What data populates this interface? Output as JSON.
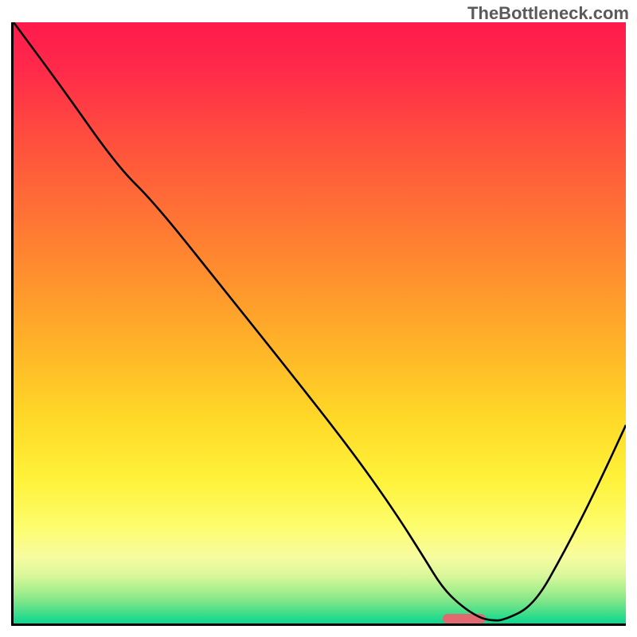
{
  "watermark": "TheBottleneck.com",
  "chart_data": {
    "type": "line",
    "title": "",
    "xlabel": "",
    "ylabel": "",
    "xlim": [
      0,
      100
    ],
    "ylim": [
      0,
      100
    ],
    "x": [
      0,
      8,
      17,
      23,
      34,
      45,
      55,
      62,
      67,
      70,
      73,
      76,
      78,
      80,
      85,
      90,
      95,
      100
    ],
    "values": [
      100,
      89,
      76,
      70,
      56,
      42,
      29,
      19,
      11,
      6,
      3,
      1,
      0.5,
      0.5,
      3,
      12,
      22,
      33
    ],
    "marker": {
      "x_start": 70,
      "x_end": 77,
      "y": 0
    },
    "gradient_stops": [
      {
        "pos": 0,
        "color": "#ff1a4d"
      },
      {
        "pos": 0.5,
        "color": "#ffd927"
      },
      {
        "pos": 0.85,
        "color": "#fdfd6e"
      },
      {
        "pos": 1.0,
        "color": "#0fd68e"
      }
    ]
  }
}
